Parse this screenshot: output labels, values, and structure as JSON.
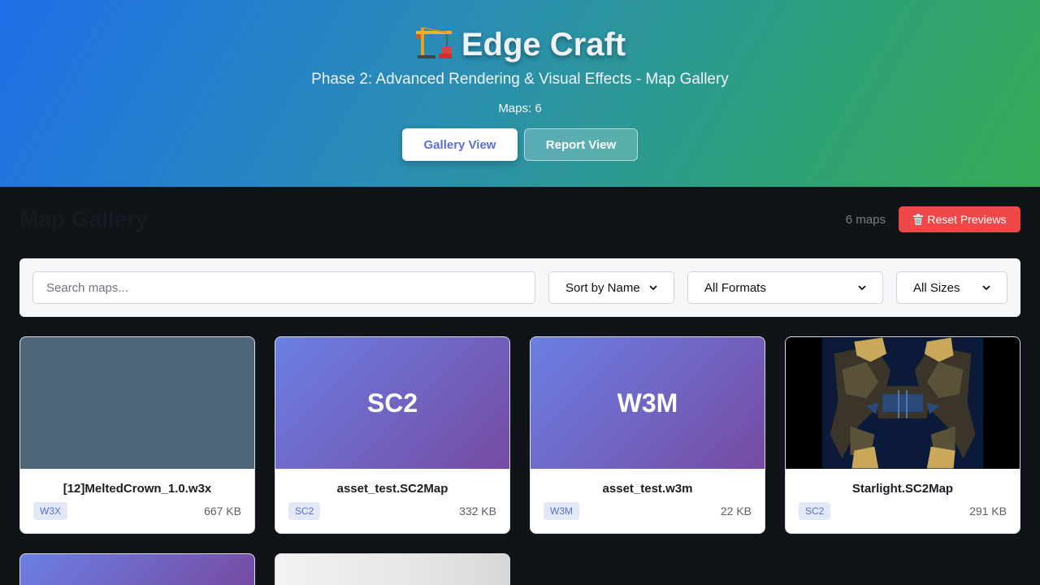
{
  "header": {
    "icon": "crane-icon",
    "title": "Edge Craft",
    "subtitle": "Phase 2: Advanced Rendering & Visual Effects - Map Gallery",
    "count_text": "Maps: 6",
    "buttons": {
      "gallery": "Gallery View",
      "report": "Report View"
    },
    "colors": {
      "gradient_start": "#1f6fe8",
      "gradient_end": "#36aa55"
    }
  },
  "gallery": {
    "title": "Map Gallery",
    "count": "6 maps",
    "reset_icon": "trash-icon",
    "reset_label": "Reset Previews",
    "reset_color": "#f04848"
  },
  "filters": {
    "search_placeholder": "Search maps...",
    "sort": "Sort by Name",
    "format": "All Formats",
    "size": "All Sizes"
  },
  "cards": [
    {
      "name": "[12]MeltedCrown_1.0.w3x",
      "badge": "W3X",
      "size": "667 KB",
      "thumb": ""
    },
    {
      "name": "asset_test.SC2Map",
      "badge": "SC2",
      "size": "332 KB",
      "thumb": "SC2"
    },
    {
      "name": "asset_test.w3m",
      "badge": "W3M",
      "size": "22 KB",
      "thumb": "W3M"
    },
    {
      "name": "Starlight.SC2Map",
      "badge": "SC2",
      "size": "291 KB",
      "thumb": ""
    }
  ]
}
